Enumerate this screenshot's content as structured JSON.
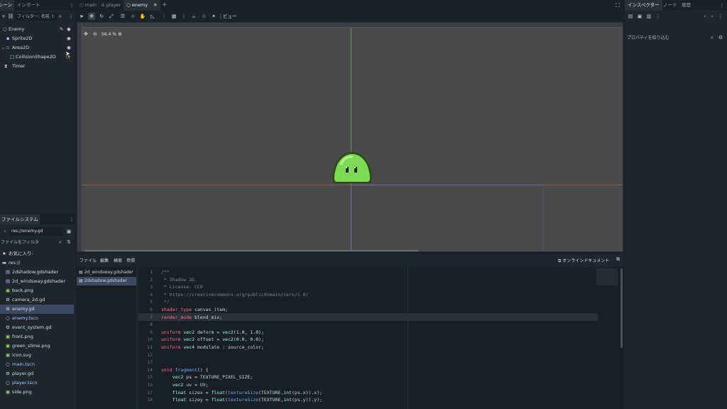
{
  "left_top": {
    "tabs": [
      "シーン",
      "インポート"
    ],
    "filter_placeholder": "フィルター: 名前, t",
    "nodes": [
      {
        "label": "Enemy",
        "icon": "node2d-icon"
      },
      {
        "label": "Sprite2D",
        "icon": "sprite-icon"
      },
      {
        "label": "Area2D",
        "icon": "area-icon"
      },
      {
        "label": "CollisionShape2D",
        "icon": "collision-icon"
      },
      {
        "label": "Timer",
        "icon": "timer-icon"
      }
    ]
  },
  "filesystem": {
    "tab": "ファイルシステム",
    "path": "res://enemy.gd",
    "filter_placeholder": "ファイルをフィルタ",
    "favorites": "お気に入り:",
    "root": "res://",
    "files": [
      {
        "name": "2dshadow.gdshader",
        "icon": "shader-icon"
      },
      {
        "name": "2d_windsway.gdshader",
        "icon": "shader-icon"
      },
      {
        "name": "back.png",
        "icon": "image-icon"
      },
      {
        "name": "camera_2d.gd",
        "icon": "script-icon"
      },
      {
        "name": "enemy.gd",
        "icon": "script-icon"
      },
      {
        "name": "enemy.tscn",
        "icon": "scene-icon"
      },
      {
        "name": "event_system.gd",
        "icon": "script-icon"
      },
      {
        "name": "front.png",
        "icon": "image-icon"
      },
      {
        "name": "green_slime.png",
        "icon": "image-icon"
      },
      {
        "name": "icon.svg",
        "icon": "image-icon"
      },
      {
        "name": "main.tscn",
        "icon": "scene-icon"
      },
      {
        "name": "player.gd",
        "icon": "script-icon"
      },
      {
        "name": "player.tscn",
        "icon": "scene-icon"
      },
      {
        "name": "side.png",
        "icon": "image-icon"
      }
    ]
  },
  "scene_tabs": [
    "main",
    "player",
    "enemy"
  ],
  "toolbar": {
    "view_label": "ビュー"
  },
  "viewport": {
    "zoom": "56.4 %"
  },
  "bottom_panel": {
    "menu": [
      "ファイル",
      "編集",
      "検索",
      "参照"
    ],
    "online_docs": "オンラインドキュメント",
    "shader_files": [
      "2d_windsway.gdshader",
      "2dshadow.gdshader"
    ]
  },
  "code": [
    {
      "n": "1",
      "t": "/**"
    },
    {
      "n": "2",
      "t": " * Shadow 2D."
    },
    {
      "n": "3",
      "t": " * License: CC0"
    },
    {
      "n": "4",
      "t": " * https://creativecommons.org/publicdomain/zero/1.0/"
    },
    {
      "n": "5",
      "t": " */"
    },
    {
      "n": "6",
      "t": "shader_type canvas_item;"
    },
    {
      "n": "7",
      "t": "render_mode blend_mix;"
    },
    {
      "n": "8",
      "t": ""
    },
    {
      "n": "9",
      "t": "uniform vec2 deform = vec2(1.0, 1.0);"
    },
    {
      "n": "10",
      "t": "uniform vec2 offset = vec2(0.0, 0.0);"
    },
    {
      "n": "11",
      "t": "uniform vec4 modulate : source_color;"
    },
    {
      "n": "12",
      "t": ""
    },
    {
      "n": "13",
      "t": ""
    },
    {
      "n": "14",
      "t": "void fragment() {"
    },
    {
      "n": "15",
      "t": "    vec2 ps = TEXTURE_PIXEL_SIZE;"
    },
    {
      "n": "16",
      "t": "    vec2 uv = UV;"
    },
    {
      "n": "17",
      "t": "    float sizex = float(textureSize(TEXTURE,int(ps.x)).x);"
    },
    {
      "n": "18",
      "t": "    float sizey = float(textureSize(TEXTURE,int(ps.y)).y);"
    }
  ],
  "inspector": {
    "tabs": [
      "インスペクター",
      "ノード",
      "履歴"
    ],
    "filter_placeholder": "プロパティを絞り込む"
  },
  "colors": {
    "accent": "#5fa8ff",
    "slime": "#7ed956",
    "bg": "#1d2229"
  }
}
